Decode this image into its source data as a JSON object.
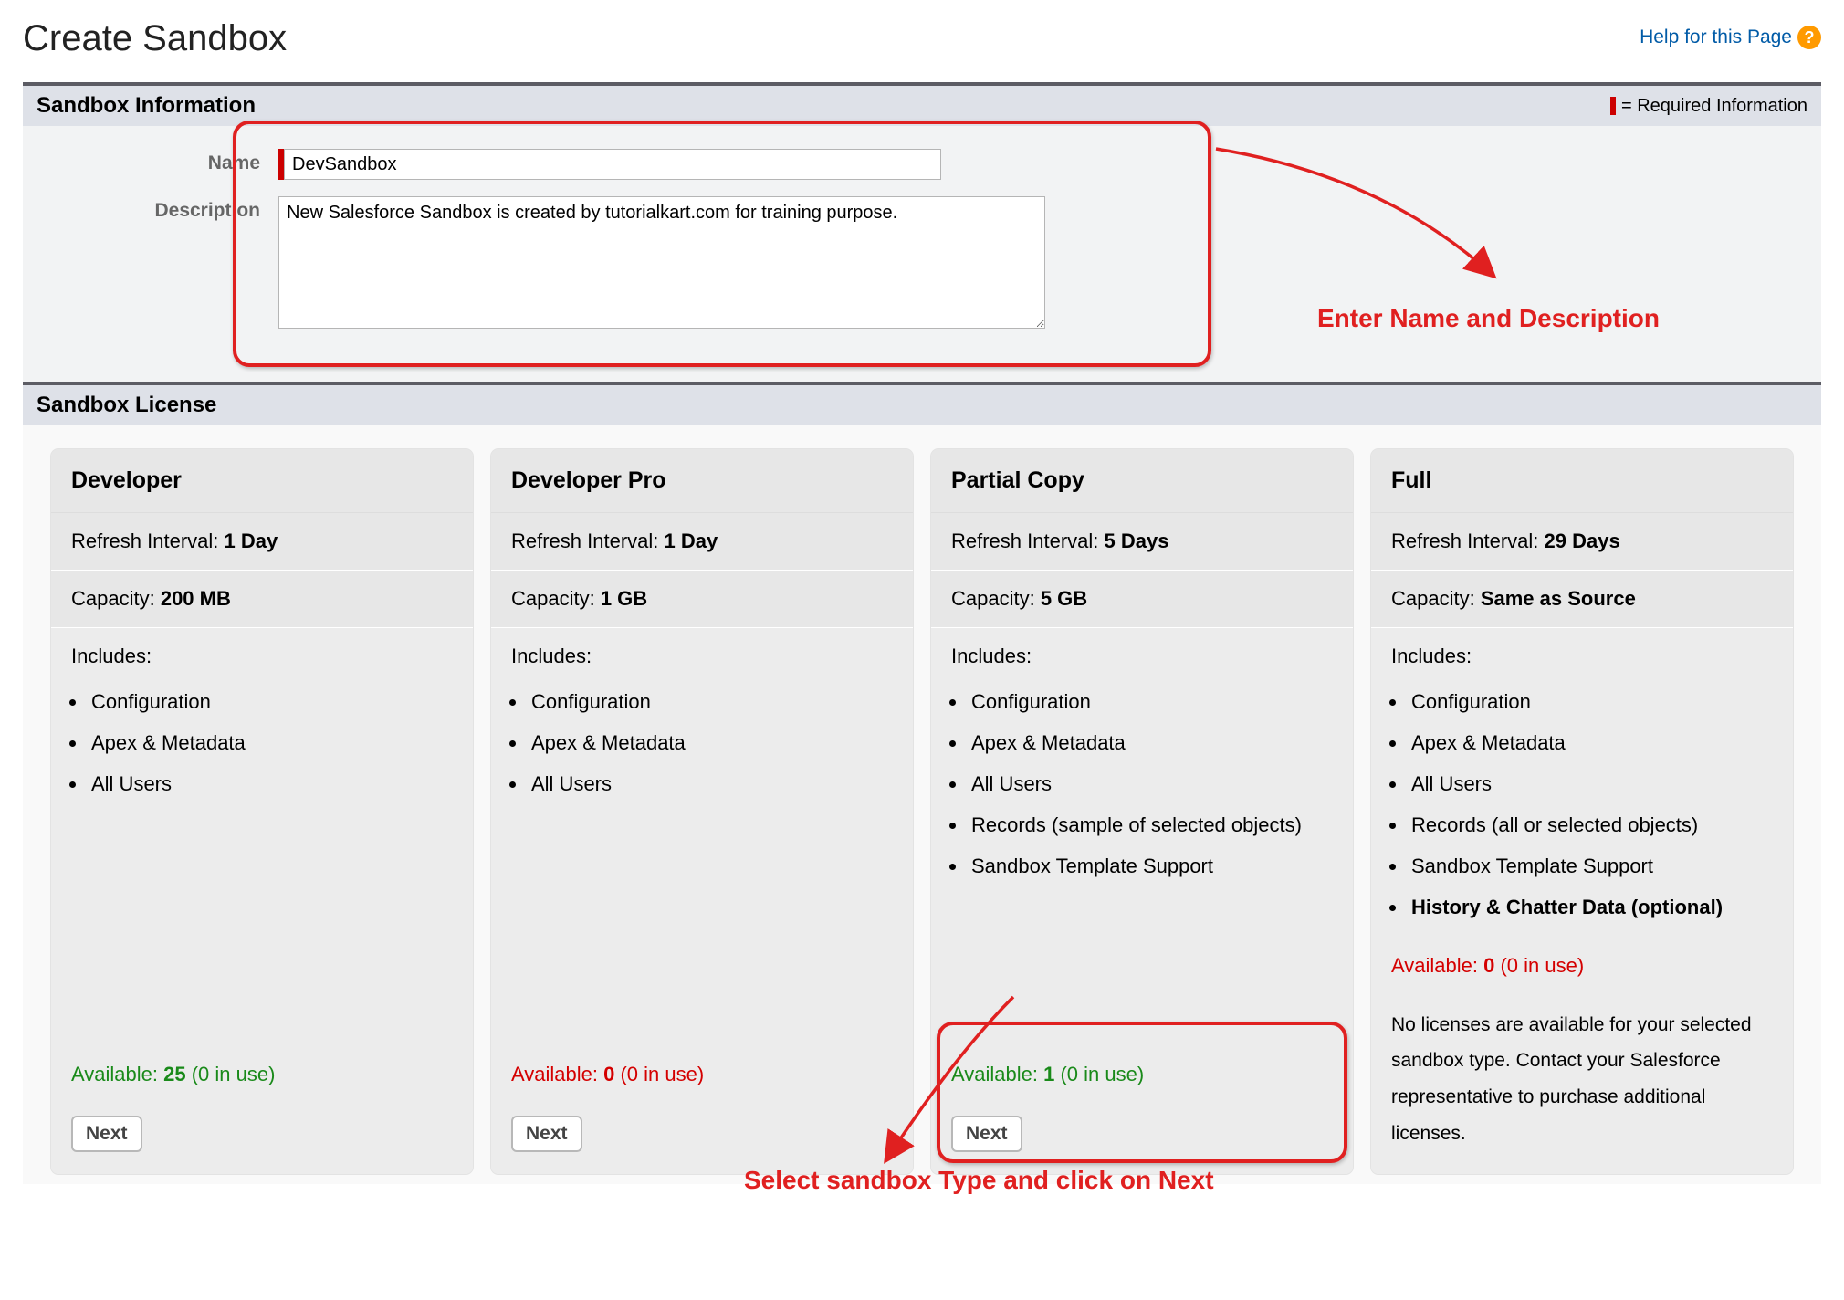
{
  "page_title": "Create Sandbox",
  "help_link_label": "Help for this Page",
  "sections": {
    "info_title": "Sandbox Information",
    "required_label": "= Required Information",
    "license_title": "Sandbox License"
  },
  "form": {
    "name_label": "Name",
    "name_value": "DevSandbox",
    "description_label": "Description",
    "description_value": "New Salesforce Sandbox is created by tutorialkart.com for training purpose."
  },
  "annotations": {
    "name_desc": "Enter Name and Description",
    "select_type": "Select sandbox Type and click on Next"
  },
  "labels": {
    "refresh_interval": "Refresh Interval:",
    "capacity": "Capacity:",
    "includes": "Includes:",
    "available": "Available:",
    "in_use_suffix": "(0 in use)",
    "next_button": "Next"
  },
  "licenses": [
    {
      "title": "Developer",
      "refresh_interval": "1 Day",
      "capacity": "200 MB",
      "includes": [
        "Configuration",
        "Apex & Metadata",
        "All Users"
      ],
      "available_count": "25",
      "available_status": "green",
      "action": "next"
    },
    {
      "title": "Developer Pro",
      "refresh_interval": "1 Day",
      "capacity": "1 GB",
      "includes": [
        "Configuration",
        "Apex & Metadata",
        "All Users"
      ],
      "available_count": "0",
      "available_status": "red",
      "action": "next"
    },
    {
      "title": "Partial Copy",
      "refresh_interval": "5 Days",
      "capacity": "5 GB",
      "includes": [
        "Configuration",
        "Apex & Metadata",
        "All Users",
        "Records (sample of selected objects)",
        "Sandbox Template Support"
      ],
      "available_count": "1",
      "available_status": "green",
      "action": "next"
    },
    {
      "title": "Full",
      "refresh_interval": "29 Days",
      "capacity": "Same as Source",
      "includes": [
        "Configuration",
        "Apex & Metadata",
        "All Users",
        "Records (all or selected objects)",
        "Sandbox Template Support"
      ],
      "includes_bold_last": "History & Chatter Data (optional)",
      "available_count": "0",
      "available_status": "red",
      "action": "message",
      "action_message": "No licenses are available for your selected sandbox type. Contact your Salesforce representative to purchase additional licenses."
    }
  ]
}
